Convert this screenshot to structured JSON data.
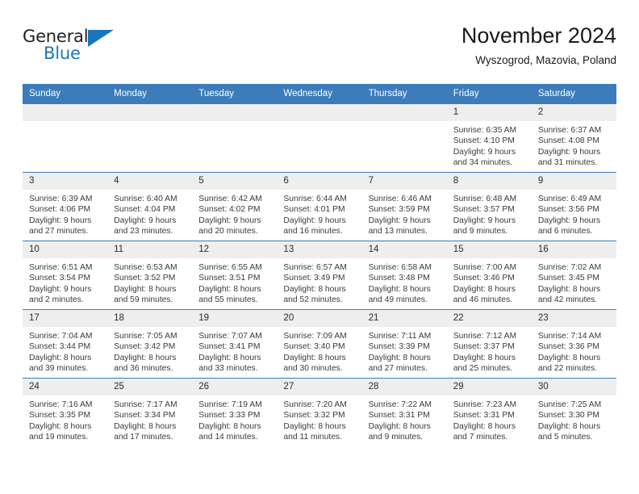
{
  "brand": {
    "name_part1": "General",
    "name_part2": "Blue",
    "accent_color": "#1b75bb"
  },
  "header": {
    "title": "November 2024",
    "subtitle": "Wyszogrod, Mazovia, Poland"
  },
  "theme": {
    "header_band": "#3c7cba",
    "daynum_band": "#eeeeee"
  },
  "weekday_headers": [
    "Sunday",
    "Monday",
    "Tuesday",
    "Wednesday",
    "Thursday",
    "Friday",
    "Saturday"
  ],
  "weeks": [
    [
      {
        "day": "",
        "lines": []
      },
      {
        "day": "",
        "lines": []
      },
      {
        "day": "",
        "lines": []
      },
      {
        "day": "",
        "lines": []
      },
      {
        "day": "",
        "lines": []
      },
      {
        "day": "1",
        "lines": [
          "Sunrise: 6:35 AM",
          "Sunset: 4:10 PM",
          "Daylight: 9 hours",
          "and 34 minutes."
        ]
      },
      {
        "day": "2",
        "lines": [
          "Sunrise: 6:37 AM",
          "Sunset: 4:08 PM",
          "Daylight: 9 hours",
          "and 31 minutes."
        ]
      }
    ],
    [
      {
        "day": "3",
        "lines": [
          "Sunrise: 6:39 AM",
          "Sunset: 4:06 PM",
          "Daylight: 9 hours",
          "and 27 minutes."
        ]
      },
      {
        "day": "4",
        "lines": [
          "Sunrise: 6:40 AM",
          "Sunset: 4:04 PM",
          "Daylight: 9 hours",
          "and 23 minutes."
        ]
      },
      {
        "day": "5",
        "lines": [
          "Sunrise: 6:42 AM",
          "Sunset: 4:02 PM",
          "Daylight: 9 hours",
          "and 20 minutes."
        ]
      },
      {
        "day": "6",
        "lines": [
          "Sunrise: 6:44 AM",
          "Sunset: 4:01 PM",
          "Daylight: 9 hours",
          "and 16 minutes."
        ]
      },
      {
        "day": "7",
        "lines": [
          "Sunrise: 6:46 AM",
          "Sunset: 3:59 PM",
          "Daylight: 9 hours",
          "and 13 minutes."
        ]
      },
      {
        "day": "8",
        "lines": [
          "Sunrise: 6:48 AM",
          "Sunset: 3:57 PM",
          "Daylight: 9 hours",
          "and 9 minutes."
        ]
      },
      {
        "day": "9",
        "lines": [
          "Sunrise: 6:49 AM",
          "Sunset: 3:56 PM",
          "Daylight: 9 hours",
          "and 6 minutes."
        ]
      }
    ],
    [
      {
        "day": "10",
        "lines": [
          "Sunrise: 6:51 AM",
          "Sunset: 3:54 PM",
          "Daylight: 9 hours",
          "and 2 minutes."
        ]
      },
      {
        "day": "11",
        "lines": [
          "Sunrise: 6:53 AM",
          "Sunset: 3:52 PM",
          "Daylight: 8 hours",
          "and 59 minutes."
        ]
      },
      {
        "day": "12",
        "lines": [
          "Sunrise: 6:55 AM",
          "Sunset: 3:51 PM",
          "Daylight: 8 hours",
          "and 55 minutes."
        ]
      },
      {
        "day": "13",
        "lines": [
          "Sunrise: 6:57 AM",
          "Sunset: 3:49 PM",
          "Daylight: 8 hours",
          "and 52 minutes."
        ]
      },
      {
        "day": "14",
        "lines": [
          "Sunrise: 6:58 AM",
          "Sunset: 3:48 PM",
          "Daylight: 8 hours",
          "and 49 minutes."
        ]
      },
      {
        "day": "15",
        "lines": [
          "Sunrise: 7:00 AM",
          "Sunset: 3:46 PM",
          "Daylight: 8 hours",
          "and 46 minutes."
        ]
      },
      {
        "day": "16",
        "lines": [
          "Sunrise: 7:02 AM",
          "Sunset: 3:45 PM",
          "Daylight: 8 hours",
          "and 42 minutes."
        ]
      }
    ],
    [
      {
        "day": "17",
        "lines": [
          "Sunrise: 7:04 AM",
          "Sunset: 3:44 PM",
          "Daylight: 8 hours",
          "and 39 minutes."
        ]
      },
      {
        "day": "18",
        "lines": [
          "Sunrise: 7:05 AM",
          "Sunset: 3:42 PM",
          "Daylight: 8 hours",
          "and 36 minutes."
        ]
      },
      {
        "day": "19",
        "lines": [
          "Sunrise: 7:07 AM",
          "Sunset: 3:41 PM",
          "Daylight: 8 hours",
          "and 33 minutes."
        ]
      },
      {
        "day": "20",
        "lines": [
          "Sunrise: 7:09 AM",
          "Sunset: 3:40 PM",
          "Daylight: 8 hours",
          "and 30 minutes."
        ]
      },
      {
        "day": "21",
        "lines": [
          "Sunrise: 7:11 AM",
          "Sunset: 3:39 PM",
          "Daylight: 8 hours",
          "and 27 minutes."
        ]
      },
      {
        "day": "22",
        "lines": [
          "Sunrise: 7:12 AM",
          "Sunset: 3:37 PM",
          "Daylight: 8 hours",
          "and 25 minutes."
        ]
      },
      {
        "day": "23",
        "lines": [
          "Sunrise: 7:14 AM",
          "Sunset: 3:36 PM",
          "Daylight: 8 hours",
          "and 22 minutes."
        ]
      }
    ],
    [
      {
        "day": "24",
        "lines": [
          "Sunrise: 7:16 AM",
          "Sunset: 3:35 PM",
          "Daylight: 8 hours",
          "and 19 minutes."
        ]
      },
      {
        "day": "25",
        "lines": [
          "Sunrise: 7:17 AM",
          "Sunset: 3:34 PM",
          "Daylight: 8 hours",
          "and 17 minutes."
        ]
      },
      {
        "day": "26",
        "lines": [
          "Sunrise: 7:19 AM",
          "Sunset: 3:33 PM",
          "Daylight: 8 hours",
          "and 14 minutes."
        ]
      },
      {
        "day": "27",
        "lines": [
          "Sunrise: 7:20 AM",
          "Sunset: 3:32 PM",
          "Daylight: 8 hours",
          "and 11 minutes."
        ]
      },
      {
        "day": "28",
        "lines": [
          "Sunrise: 7:22 AM",
          "Sunset: 3:31 PM",
          "Daylight: 8 hours",
          "and 9 minutes."
        ]
      },
      {
        "day": "29",
        "lines": [
          "Sunrise: 7:23 AM",
          "Sunset: 3:31 PM",
          "Daylight: 8 hours",
          "and 7 minutes."
        ]
      },
      {
        "day": "30",
        "lines": [
          "Sunrise: 7:25 AM",
          "Sunset: 3:30 PM",
          "Daylight: 8 hours",
          "and 5 minutes."
        ]
      }
    ]
  ]
}
